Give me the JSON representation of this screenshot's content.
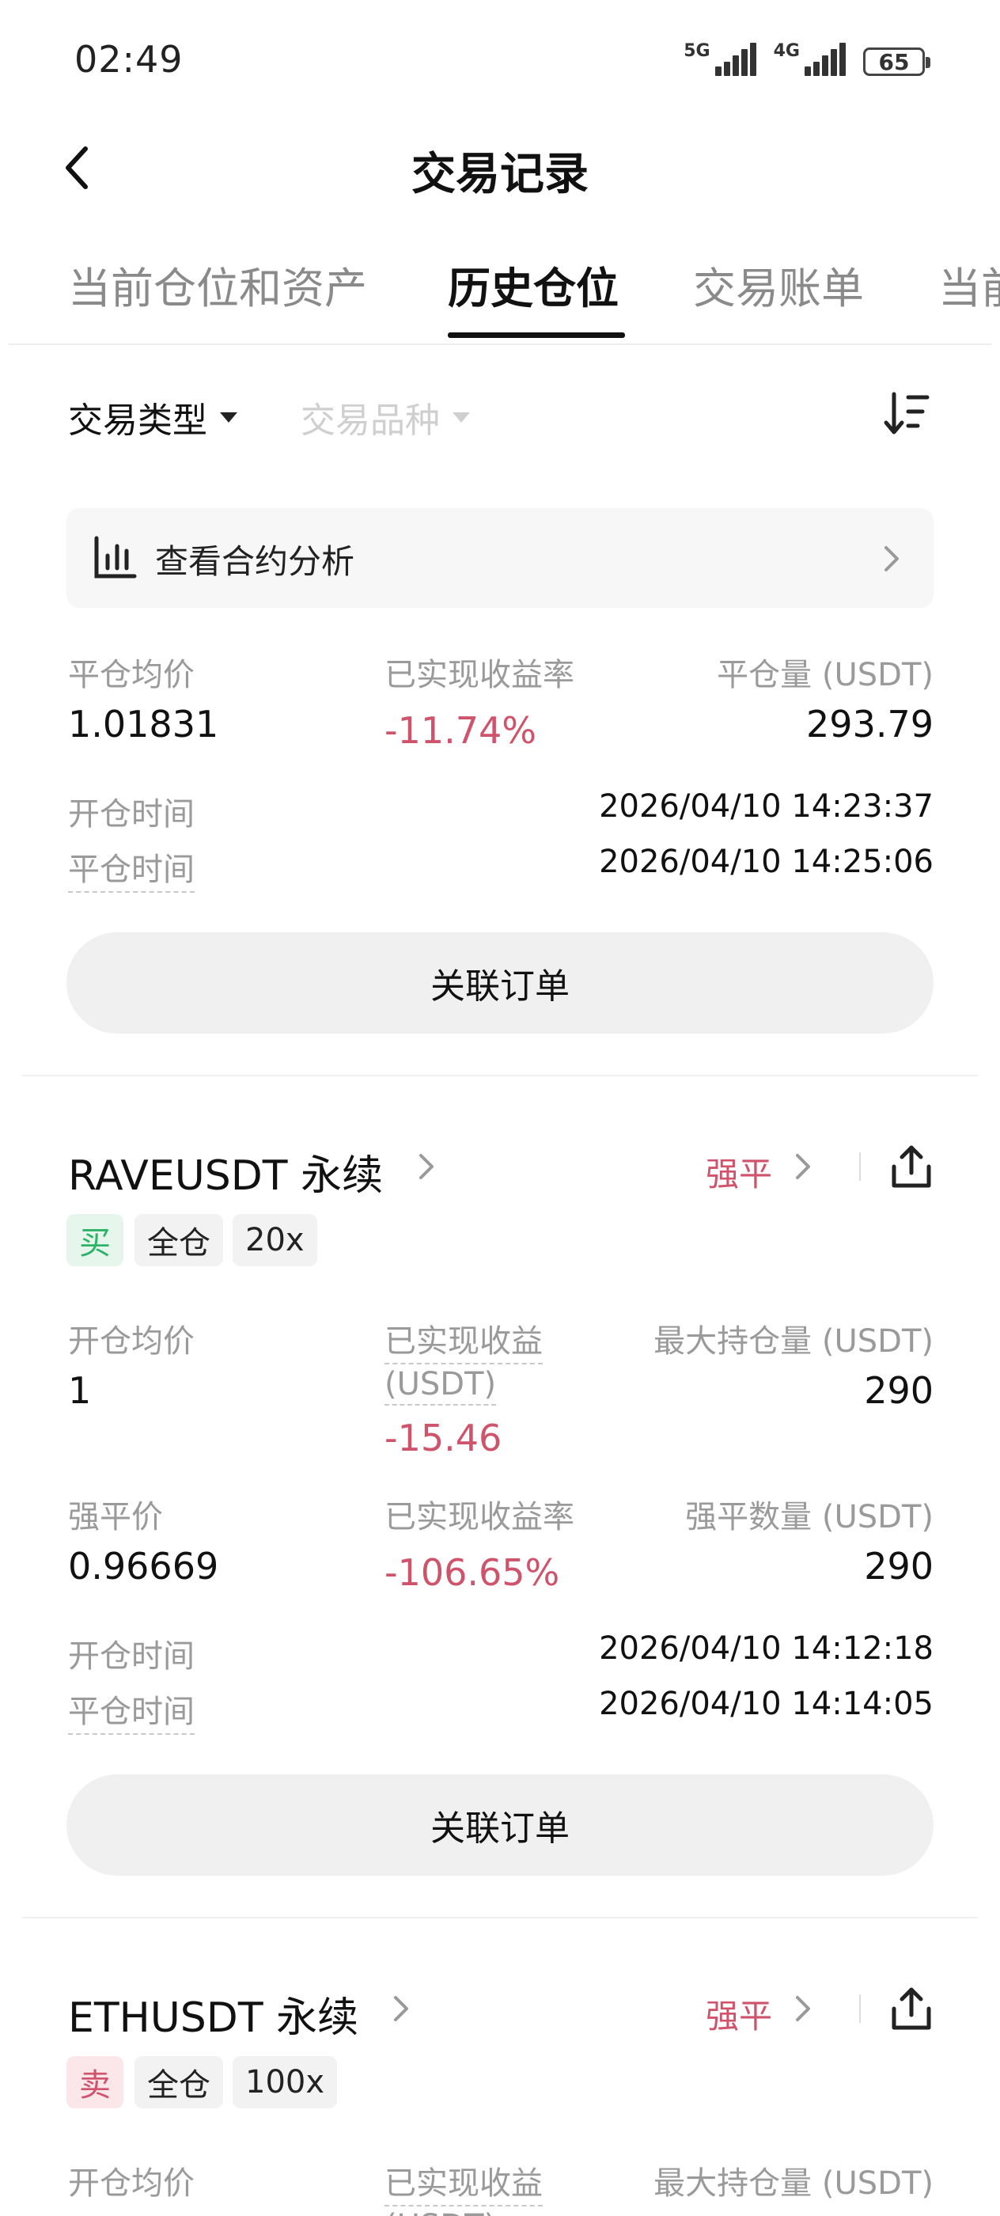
{
  "status_bar": {
    "time": "02:49",
    "net1": "5G",
    "net2": "4G",
    "battery": "65"
  },
  "header": {
    "title": "交易记录"
  },
  "tabs": [
    {
      "label": "当前仓位和资产"
    },
    {
      "label": "历史仓位"
    },
    {
      "label": "交易账单"
    },
    {
      "label": "当前"
    }
  ],
  "filters": {
    "trade_type": "交易类型",
    "trade_symbol": "交易品种"
  },
  "analysis": {
    "label": "查看合约分析"
  },
  "card1": {
    "avg_close_label": "平仓均价",
    "avg_close_value": "1.01831",
    "realized_rate_label": "已实现收益率",
    "realized_rate_value": "-11.74%",
    "close_amount_label": "平仓量 (USDT)",
    "close_amount_value": "293.79",
    "open_time_label": "开仓时间",
    "open_time_value": "2026/04/10 14:23:37",
    "close_time_label": "平仓时间",
    "close_time_value": "2026/04/10 14:25:06",
    "related_orders": "关联订单"
  },
  "card2": {
    "symbol": "RAVEUSDT 永续",
    "status": "强平",
    "tags": [
      "买",
      "全仓",
      "20x"
    ],
    "avg_open_label": "开仓均价",
    "avg_open_value": "1",
    "realized_pnl_label_1": "已实现收益",
    "realized_pnl_label_2": "(USDT)",
    "realized_pnl_value": "-15.46",
    "max_position_label": "最大持仓量 (USDT)",
    "max_position_value": "290",
    "liq_price_label": "强平价",
    "liq_price_value": "0.96669",
    "realized_rate_label": "已实现收益率",
    "realized_rate_value": "-106.65%",
    "liq_amount_label": "强平数量 (USDT)",
    "liq_amount_value": "290",
    "open_time_label": "开仓时间",
    "open_time_value": "2026/04/10 14:12:18",
    "close_time_label": "平仓时间",
    "close_time_value": "2026/04/10 14:14:05",
    "related_orders": "关联订单"
  },
  "card3": {
    "symbol": "ETHUSDT 永续",
    "status": "强平",
    "tags": [
      "卖",
      "全仓",
      "100x"
    ],
    "avg_open_label": "开仓均价",
    "realized_pnl_label_1": "已实现收益",
    "realized_pnl_label_2": "(USDT)",
    "max_position_label": "最大持仓量 (USDT)"
  },
  "colors": {
    "negative": "#d0536c",
    "buy": "#2db366",
    "muted": "#9a9a9a"
  }
}
